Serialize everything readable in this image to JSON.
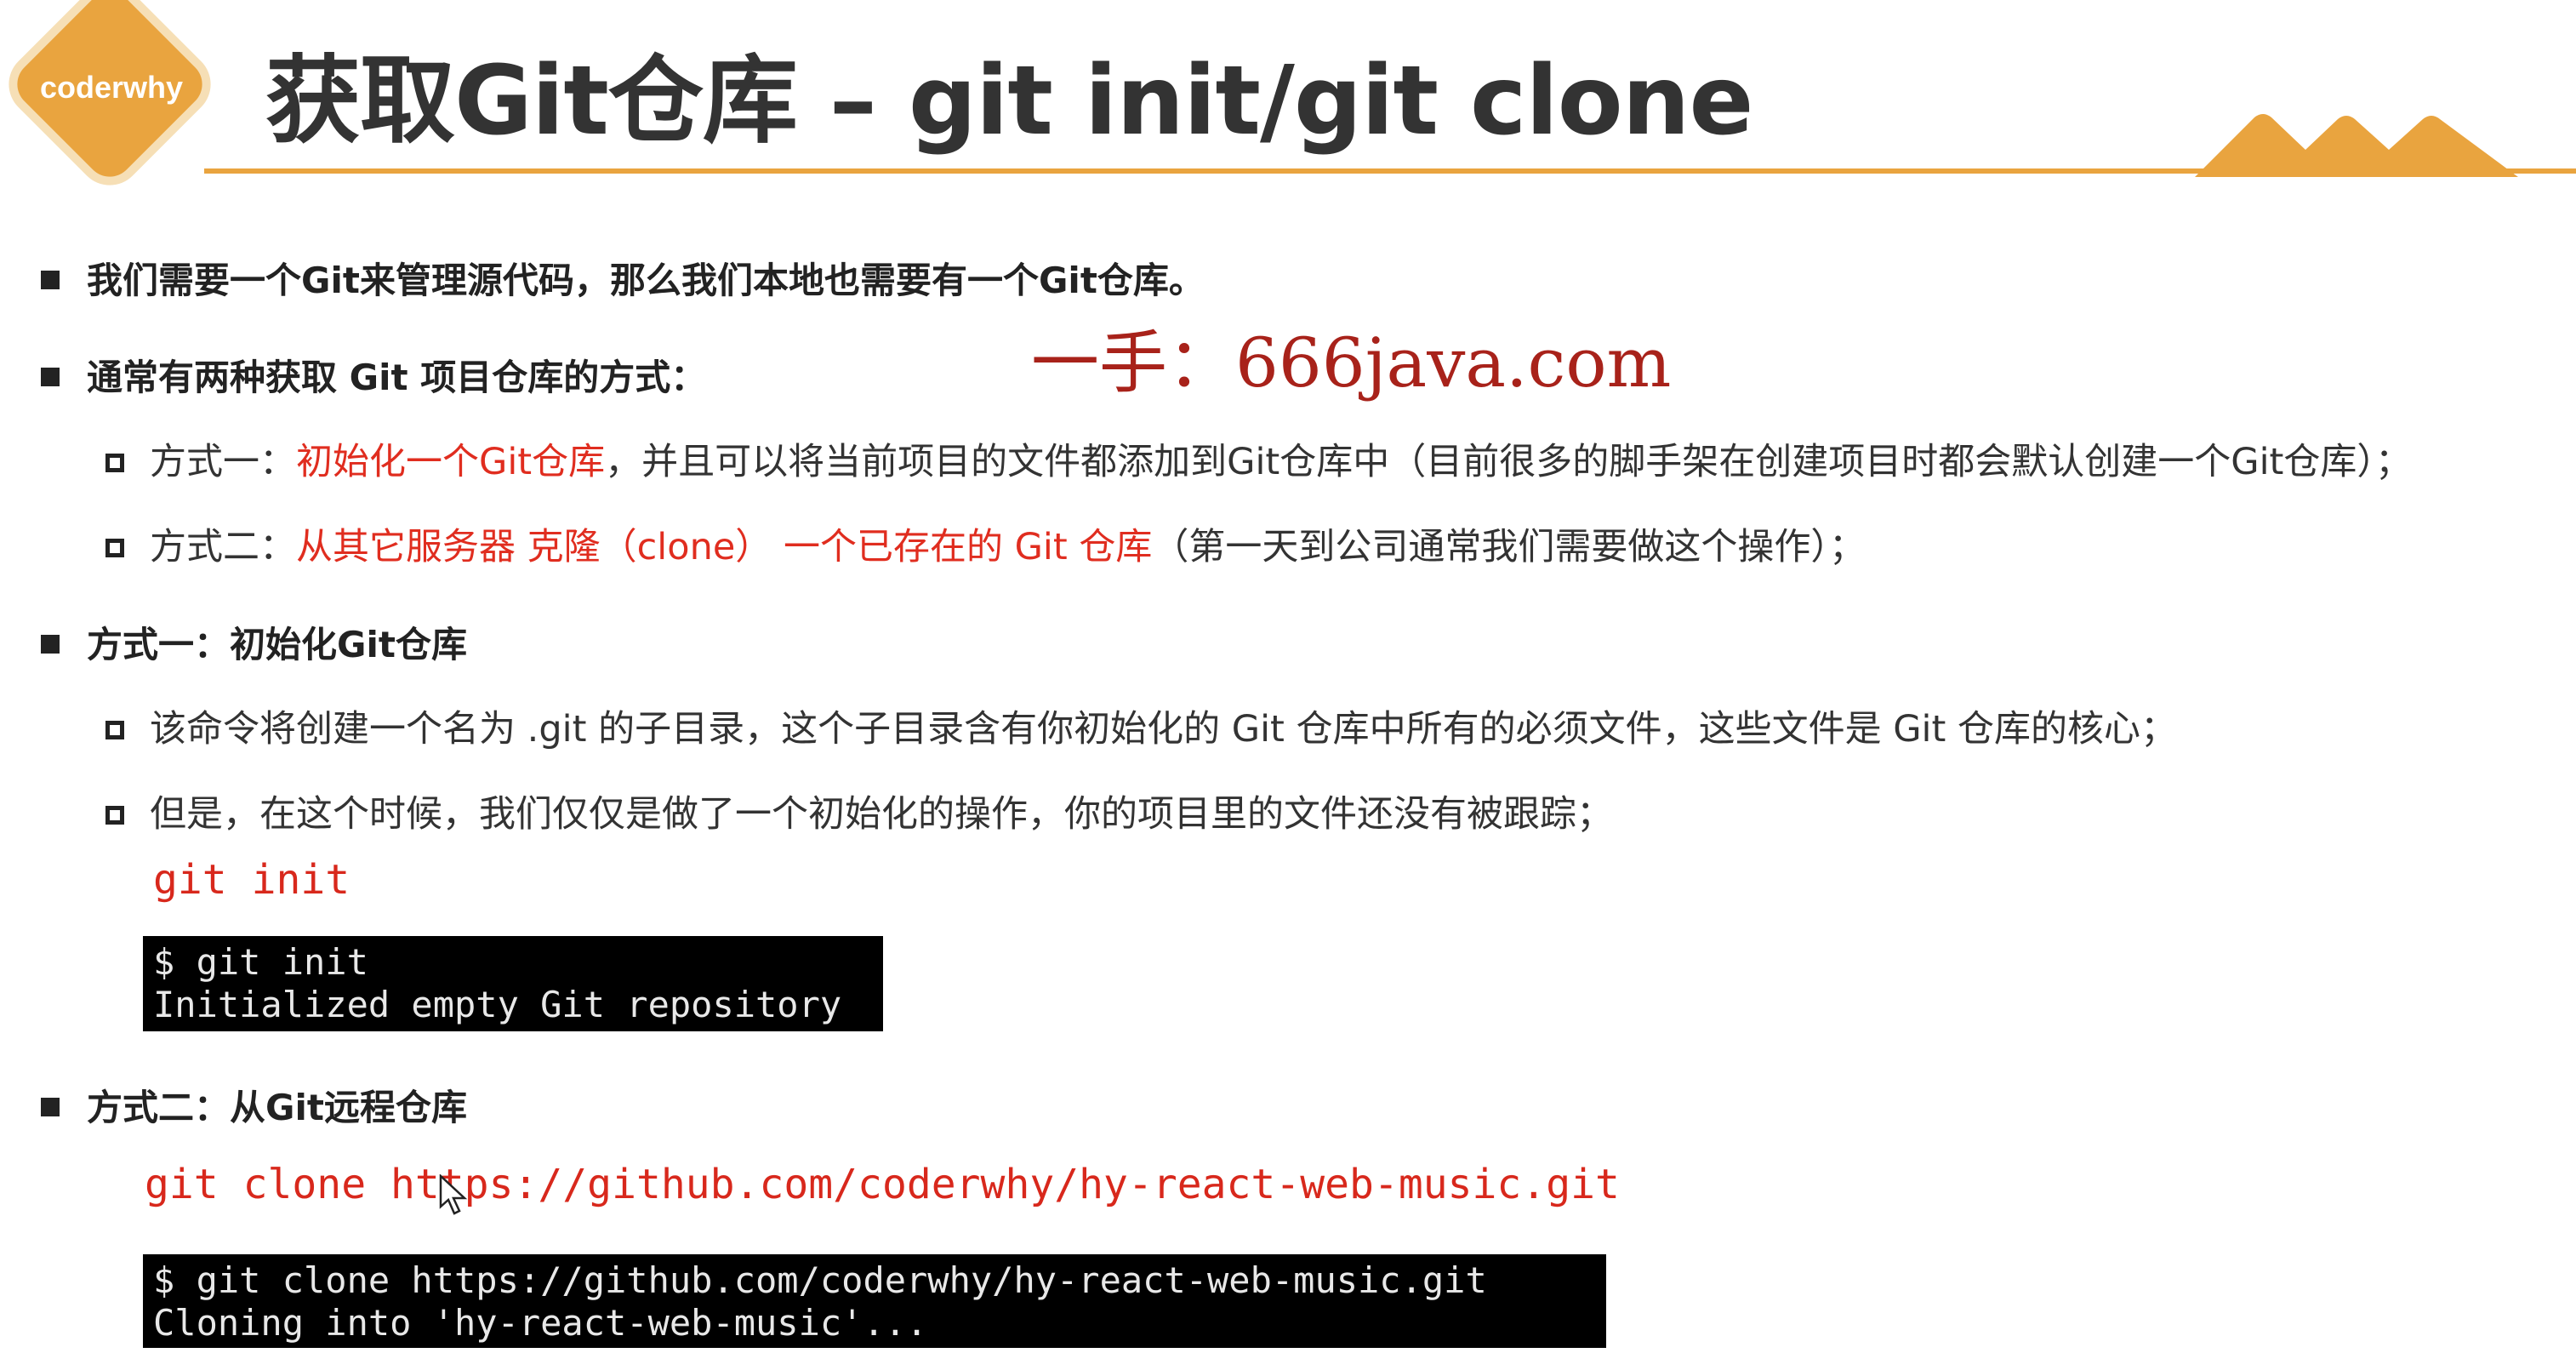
{
  "logo": {
    "text": "coderwhy"
  },
  "title": "获取Git仓库 – git init/git clone",
  "watermark": "一手：666java.com",
  "bullets": [
    {
      "text": "我们需要一个Git来管理源代码，那么我们本地也需要有一个Git仓库。"
    },
    {
      "text": "通常有两种获取 Git 项目仓库的方式："
    },
    {
      "prefix": "方式一：",
      "highlight": "初始化一个Git仓库",
      "rest": "，并且可以将当前项目的文件都添加到Git仓库中（目前很多的脚手架在创建项目时都会默认创建一个Git仓库）；"
    },
    {
      "prefix": "方式二：",
      "highlight": "从其它服务器 克隆（clone） 一个已存在的 Git 仓库",
      "rest": "（第一天到公司通常我们需要做这个操作）；"
    },
    {
      "text": "方式一：初始化Git仓库"
    },
    {
      "text": "该命令将创建一个名为 .git 的子目录，这个子目录含有你初始化的 Git 仓库中所有的必须文件，这些文件是 Git 仓库的核心；"
    },
    {
      "text": "但是，在这个时候，我们仅仅是做了一个初始化的操作，你的项目里的文件还没有被跟踪；"
    },
    {
      "text": "方式二：从Git远程仓库"
    }
  ],
  "code": {
    "init": "git init",
    "clone": "git clone https://github.com/coderwhy/hy-react-web-music.git"
  },
  "terminal_init": {
    "line1": "$ git init",
    "line2": "Initialized empty Git repository"
  },
  "terminal_clone": {
    "line1": "$ git clone https://github.com/coderwhy/hy-react-web-music.git",
    "line2": "Cloning into 'hy-react-web-music'..."
  },
  "colors": {
    "accent": "#e9a43f",
    "highlight": "#e02d1f",
    "watermark": "#a8221a",
    "terminal_bg": "#000000"
  }
}
